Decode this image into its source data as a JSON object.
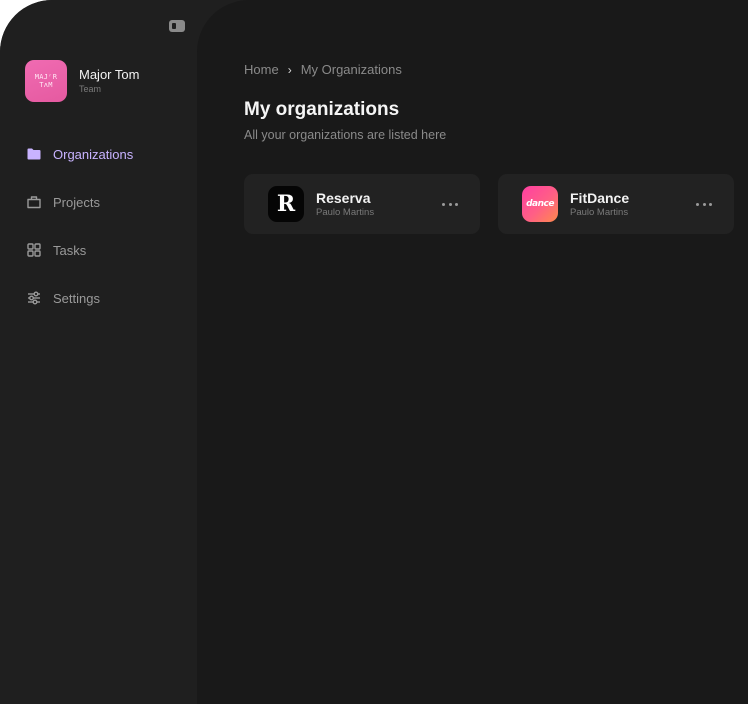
{
  "sidebar": {
    "profile": {
      "avatar_line1": "MAJʳR",
      "avatar_line2": "TʌM",
      "name": "Major Tom",
      "role": "Team"
    },
    "items": [
      {
        "label": "Organizations",
        "icon": "folder-icon",
        "active": true
      },
      {
        "label": "Projects",
        "icon": "briefcase-icon",
        "active": false
      },
      {
        "label": "Tasks",
        "icon": "grid-icon",
        "active": false
      },
      {
        "label": "Settings",
        "icon": "sliders-icon",
        "active": false
      }
    ]
  },
  "breadcrumb": {
    "home": "Home",
    "current": "My Organizations"
  },
  "page": {
    "title": "My organizations",
    "subtitle": "All your organizations are listed here"
  },
  "organizations": [
    {
      "name": "Reserva",
      "owner": "Paulo Martins",
      "logo_letter": "R"
    },
    {
      "name": "FitDance",
      "owner": "Paulo Martins",
      "logo_text": "dance"
    }
  ],
  "colors": {
    "accent": "#c8b3ff",
    "sidebar_bg": "#1f1f1f",
    "main_bg": "#191919",
    "card_bg": "#222222",
    "avatar_pink": "#f06bb2"
  }
}
